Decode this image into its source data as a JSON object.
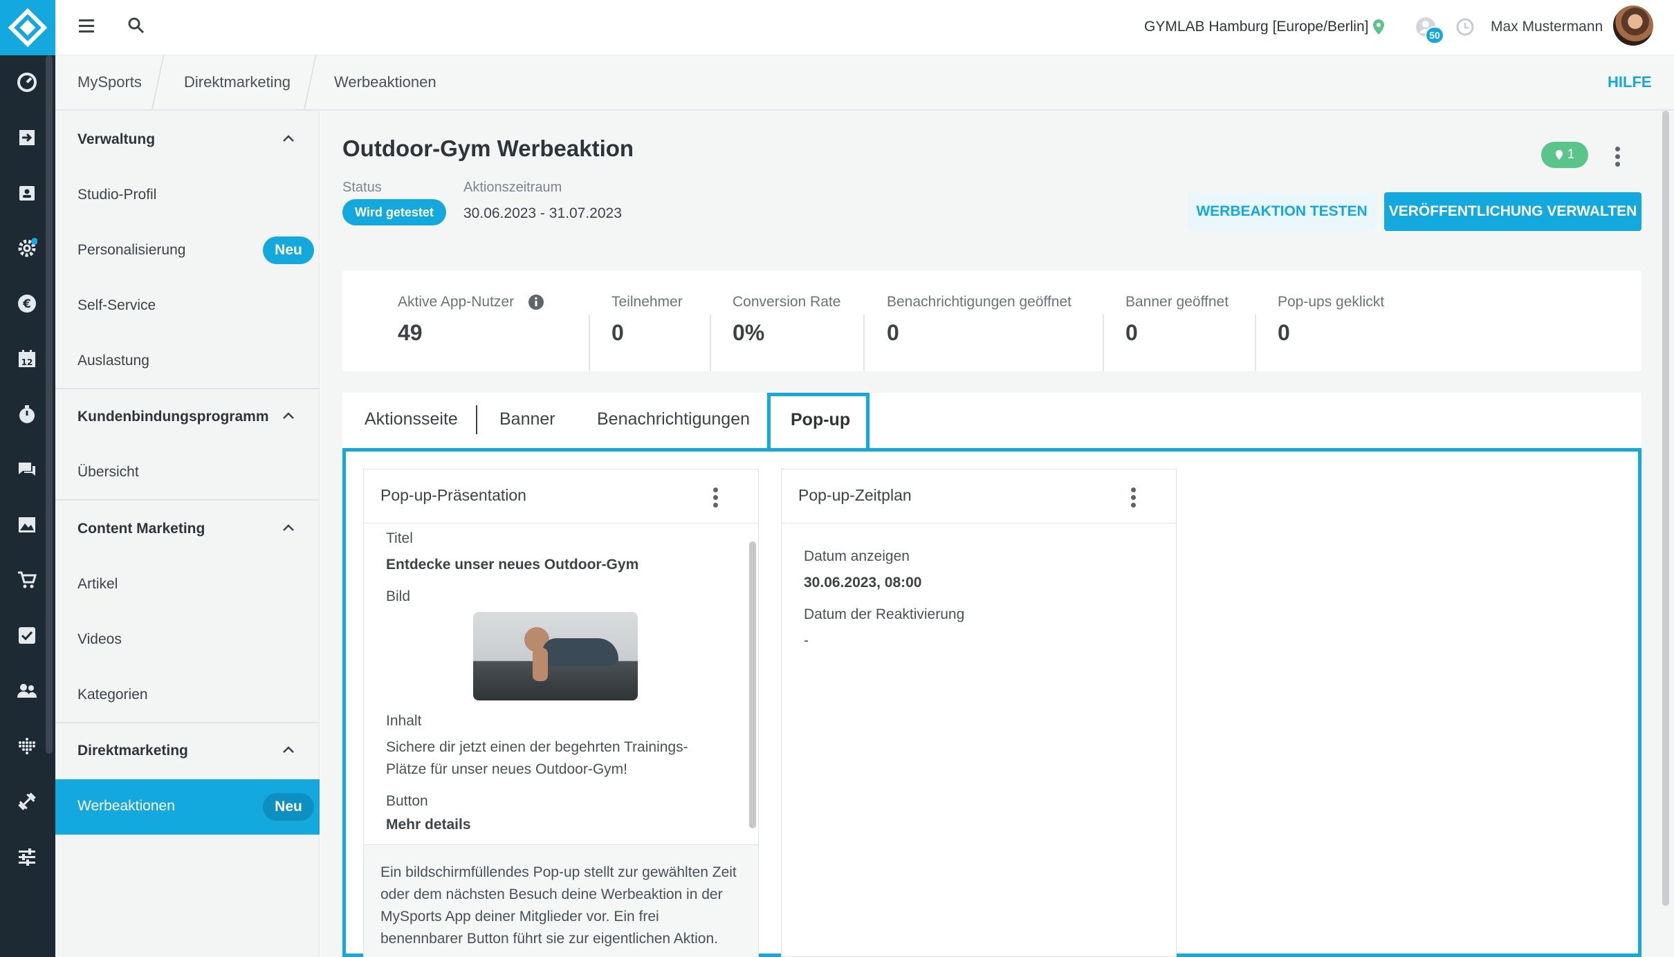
{
  "app": {
    "logo_icon": "diamond-logo-icon",
    "accent": "#14a9de"
  },
  "rail": {
    "icons": [
      "dashboard-icon",
      "check-in-icon",
      "contacts-icon",
      "settings-gear-icon",
      "euro-icon",
      "calendar-icon",
      "stopwatch-icon",
      "chat-icon",
      "image-icon",
      "cart-icon",
      "checkbox-icon",
      "people-icon",
      "grid-dots-icon",
      "dumbbell-icon",
      "sliders-icon"
    ],
    "calendar_day": "12"
  },
  "topbar": {
    "location": "GYMLAB Hamburg [Europe/Berlin]",
    "notifications_count": "50",
    "user_name": "Max Mustermann"
  },
  "breadcrumb": {
    "items": [
      "MySports",
      "Direktmarketing",
      "Werbeaktionen"
    ],
    "help": "HILFE"
  },
  "sidebar": {
    "sections": [
      {
        "title": "Verwaltung",
        "items": [
          "Studio-Profil",
          "Personalisierung",
          "Self-Service",
          "Auslastung"
        ]
      },
      {
        "title": "Kundenbindungsprogramm",
        "items": [
          "Übersicht"
        ]
      },
      {
        "title": "Content Marketing",
        "items": [
          "Artikel",
          "Videos",
          "Kategorien"
        ]
      },
      {
        "title": "Direktmarketing",
        "items": [
          "Werbeaktionen"
        ]
      }
    ],
    "badge_new": "Neu"
  },
  "page": {
    "title": "Outdoor-Gym Werbeaktion",
    "status_label": "Status",
    "status_value": "Wird getestet",
    "period_label": "Aktionszeitraum",
    "period_value": "30.06.2023 - 31.07.2023",
    "location_badge": "1",
    "test_button": "WERBEAKTION TESTEN",
    "publish_button": "VERÖFFENTLICHUNG VERWALTEN"
  },
  "stats": [
    {
      "label": "Aktive App-Nutzer",
      "value": "49"
    },
    {
      "label": "Teilnehmer",
      "value": "0"
    },
    {
      "label": "Conversion Rate",
      "value": "0%"
    },
    {
      "label": "Benachrichtigungen geöffnet",
      "value": "0"
    },
    {
      "label": "Banner geöffnet",
      "value": "0"
    },
    {
      "label": "Pop-ups geklickt",
      "value": "0"
    }
  ],
  "tabs": [
    "Aktionsseite",
    "Banner",
    "Benachrichtigungen",
    "Pop-up"
  ],
  "active_tab": "Pop-up",
  "popup_card": {
    "title": "Pop-up-Präsentation",
    "title_label": "Titel",
    "title_value": "Entdecke unser neues Outdoor-Gym",
    "image_label": "Bild",
    "content_label": "Inhalt",
    "content_line1": "Sichere dir jetzt einen der begehrten Trainings-",
    "content_line2": "Plätze für unser neues Outdoor-Gym!",
    "button_label": "Button",
    "button_value": "Mehr details",
    "footer_line1": "Ein bildschirmfüllendes Pop-up stellt zur gewählten Zeit",
    "footer_line2": "oder dem nächsten Besuch deine Werbeaktion in der",
    "footer_line3": "MySports App deiner Mitglieder vor. Ein frei",
    "footer_line4": "benennbarer Button führt sie zur eigentlichen Aktion."
  },
  "schedule_card": {
    "title": "Pop-up-Zeitplan",
    "show_label": "Datum anzeigen",
    "show_value": "30.06.2023, 08:00",
    "reactivate_label": "Datum der Reaktivierung",
    "reactivate_value": "-"
  }
}
